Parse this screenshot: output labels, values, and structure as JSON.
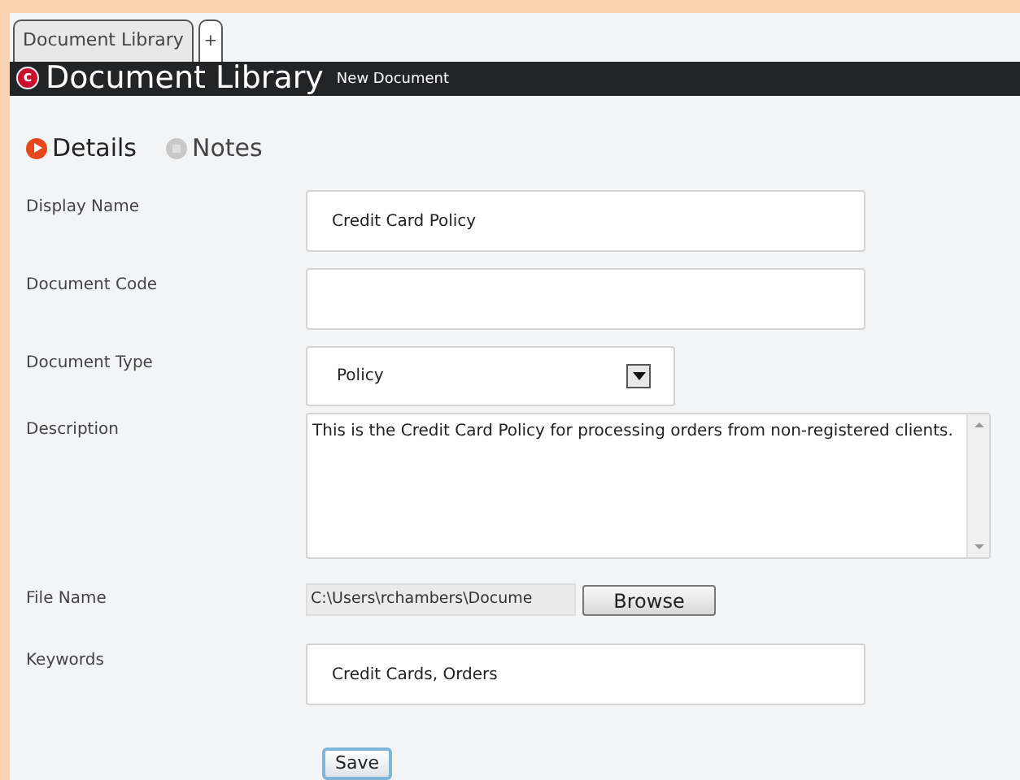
{
  "tabs": [
    {
      "label": "Document Library",
      "selected": true
    }
  ],
  "add_tab": "+",
  "header": {
    "logo": "c",
    "title": "Document Library",
    "subtitle": "New Document"
  },
  "sections": [
    {
      "label": "Details",
      "selected": true
    },
    {
      "label": "Notes",
      "selected": false
    }
  ],
  "fields": [
    {
      "kind": "text",
      "label": "Display Name",
      "value": "Credit Card Policy"
    },
    {
      "kind": "text",
      "label": "Document Code"
    },
    {
      "kind": "select",
      "label": "Document Type",
      "value": "Policy"
    },
    {
      "kind": "textarea",
      "label": "Description",
      "value": "This is the Credit Card Policy for processing orders from non-registered clients."
    },
    {
      "kind": "file",
      "label": "File Name",
      "value": "C:\\Users\\rchambers\\Docume",
      "button": "Browse"
    },
    {
      "kind": "text",
      "label": "Keywords",
      "value": "Credit Cards, Orders"
    }
  ],
  "save_button": "Save"
}
